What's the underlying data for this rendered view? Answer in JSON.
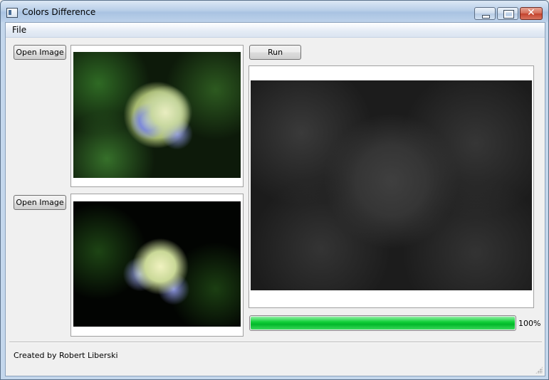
{
  "window": {
    "title": "Colors Difference"
  },
  "menubar": {
    "items": [
      {
        "label": "File"
      }
    ]
  },
  "left": {
    "open_image_1": "Open Image",
    "open_image_2": "Open Image"
  },
  "right": {
    "run_label": "Run",
    "progress": {
      "value": 100,
      "text": "100%"
    }
  },
  "footer": {
    "credit": "Created by Robert Liberski"
  },
  "icons": [
    "app-icon",
    "minimize-icon",
    "maximize-icon",
    "close-icon",
    "resize-grip-icon"
  ],
  "colors": {
    "progress_green": "#0ac832",
    "titlebar": "#b9cfe8",
    "close_red": "#c2402b"
  }
}
